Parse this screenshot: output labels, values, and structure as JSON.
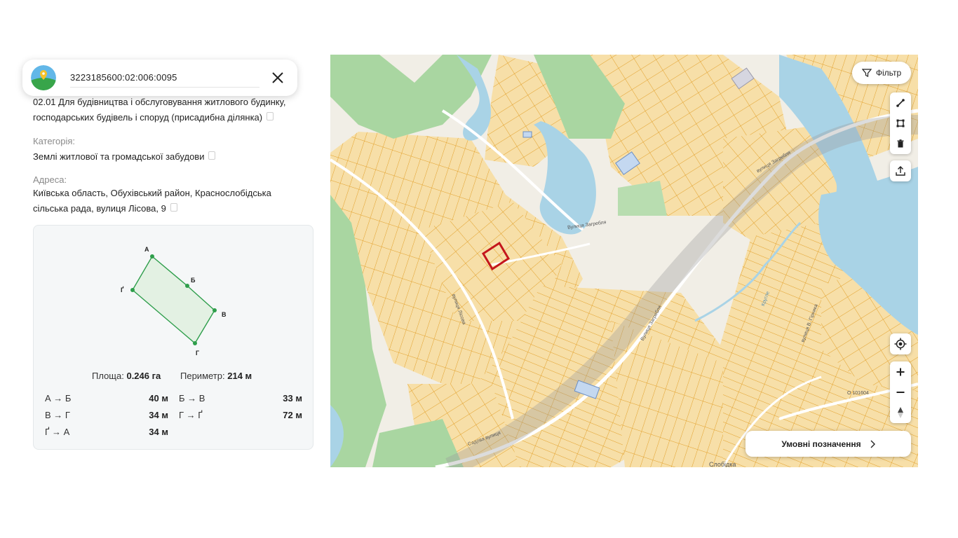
{
  "search": {
    "value": "3223185600:02:006:0095"
  },
  "purpose": {
    "line1": "02.01 Для будівництва і обслуговування житлового будинку,",
    "line2": "господарських будівель і споруд (присадибна ділянка)"
  },
  "category": {
    "label": "Категорія:",
    "value": "Землі житлової та громадської забудови"
  },
  "address": {
    "label": "Адреса:",
    "line1": "Київська область, Обухівський район, Краснослобідська",
    "line2": "сільська рада, вулиця Лісова, 9"
  },
  "shape": {
    "vertices": [
      "А",
      "Б",
      "В",
      "Ґ",
      "Г"
    ],
    "area_label": "Площа:",
    "area_value": "0.246 га",
    "perimeter_label": "Периметр:",
    "perimeter_value": "214 м",
    "segments": [
      {
        "label": "А → Б",
        "value": "40 м"
      },
      {
        "label": "Б → В",
        "value": "33 м"
      },
      {
        "label": "В → Г",
        "value": "34 м"
      },
      {
        "label": "Г → Ґ",
        "value": "72 м"
      },
      {
        "label": "Ґ → А",
        "value": "34 м"
      }
    ],
    "color": "#2e9e4b"
  },
  "map": {
    "filter_label": "Фільтр",
    "legend_label": "Умовні позначення",
    "streets": [
      "Вулиця Загребля",
      "вулиця Загребля",
      "Вулиця Загребля",
      "вулиця Лісова",
      "Садова вулиця",
      "Кругле",
      "вулиця В. Гірника",
      "О 101604",
      "Слобідка"
    ],
    "tools": [
      "ruler-icon",
      "polygon-icon",
      "trash-icon",
      "share-icon",
      "locate-icon",
      "zoom-in-icon",
      "zoom-out-icon",
      "compass-icon"
    ],
    "colors": {
      "parcel_fill": "#f7dfa8",
      "parcel_stroke": "#e2a02a",
      "water": "#a9d3e6",
      "forest": "#a9d6a1",
      "selected": "#c4161c"
    }
  }
}
